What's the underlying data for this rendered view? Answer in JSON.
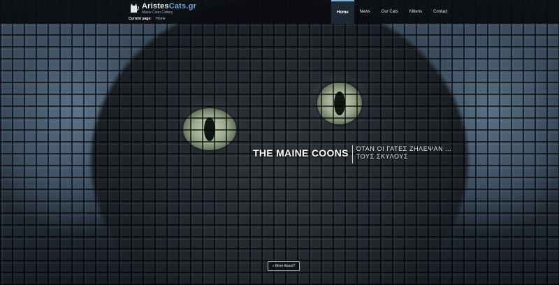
{
  "site": {
    "logo_title_main": "Aristes",
    "logo_title_accent": "Cats.gr",
    "logo_subtitle": "Maine Coon Cattery",
    "logo_icon": "cat-silhouette-icon"
  },
  "breadcrumb": {
    "label": "Current page:",
    "current": "Home"
  },
  "nav": {
    "items": [
      {
        "label": "Home",
        "active": true
      },
      {
        "label": "News",
        "active": false
      },
      {
        "label": "Our Cats",
        "active": false
      },
      {
        "label": "Kittens",
        "active": false
      },
      {
        "label": "Contact",
        "active": false
      }
    ]
  },
  "hero": {
    "title": "THE MAINE COONS",
    "subtitle_line1": "ΌΤΑΝ ΟΙ ΓΑΤΕΣ ΖΗΛΕΨΑΝ ...",
    "subtitle_line2": "ΤΟΥΣ ΣΚΥΛΟΥΣ",
    "more_button": "» More About?"
  },
  "colors": {
    "accent": "#6fa9d6",
    "topbar": "#0a0c10",
    "active_nav": "#1d2a36"
  }
}
